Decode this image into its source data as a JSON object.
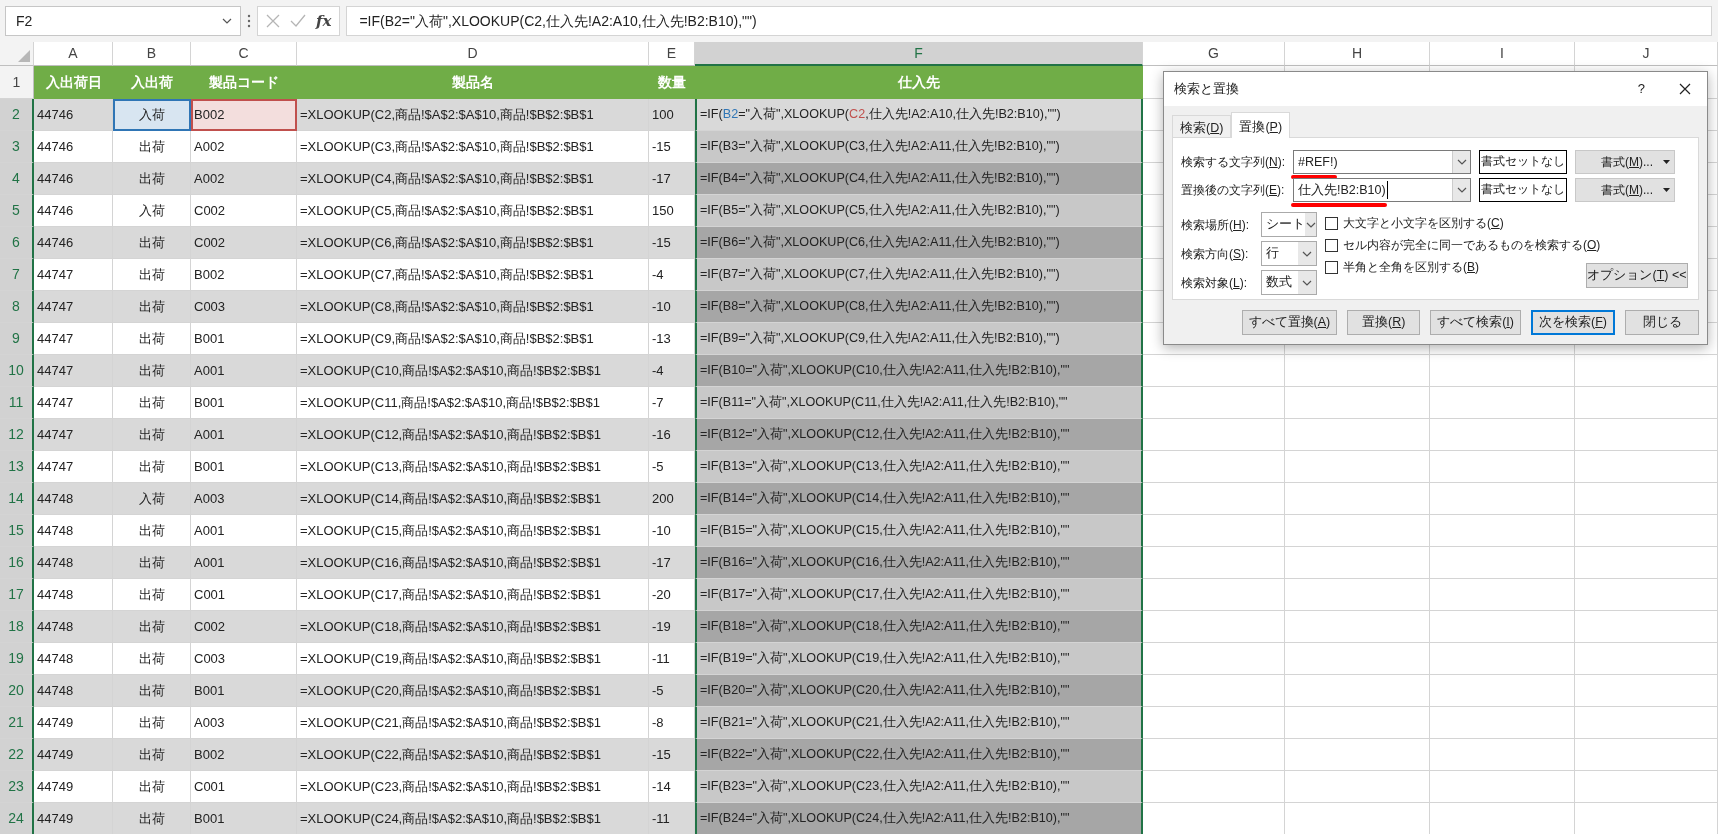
{
  "name_box": {
    "value": "F2"
  },
  "formula_bar": {
    "function_label": "fx",
    "value": "=IF(B2=\"入荷\",XLOOKUP(C2,仕入先!A2:A10,仕入先!B2:B10),\"\")"
  },
  "sheet": {
    "columns": [
      {
        "label": "A",
        "selected": false
      },
      {
        "label": "B",
        "selected": false
      },
      {
        "label": "C",
        "selected": false
      },
      {
        "label": "D",
        "selected": false
      },
      {
        "label": "E",
        "selected": false
      },
      {
        "label": "F",
        "selected": true
      },
      {
        "label": "G",
        "selected": false
      },
      {
        "label": "H",
        "selected": false
      },
      {
        "label": "I",
        "selected": false
      },
      {
        "label": "J",
        "selected": false
      }
    ],
    "header_row": {
      "number": "1",
      "selected": false,
      "cells": [
        "入出荷日",
        "入出荷",
        "製品コード",
        "製品名",
        "数量",
        "仕入先"
      ]
    },
    "rows": [
      {
        "number": "2",
        "selected": true,
        "active": true,
        "cells": [
          "44746",
          {
            "text": "入荷",
            "color": "#2f75b5"
          },
          {
            "text": "B002",
            "color": "#c0504d"
          },
          "=XLOOKUP(C2,商品!$A$2:$A$10,商品!$B$2:$B$1",
          "100",
          {
            "parts": [
              {
                "text": "=IF("
              },
              {
                "text": "B2",
                "color": "#2f75b5"
              },
              {
                "text": "=\"入荷\",XLOOKUP("
              },
              {
                "text": "C2",
                "color": "#c0504d"
              },
              {
                "text": ",仕入先!A2:A10,仕入先!B2:B10),\"\")"
              }
            ]
          }
        ]
      },
      {
        "number": "3",
        "selected": true,
        "cells": [
          "44746",
          "出荷",
          "A002",
          "=XLOOKUP(C3,商品!$A$2:$A$10,商品!$B$2:$B$1",
          "-15",
          "=IF(B3=\"入荷\",XLOOKUP(C3,仕入先!A2:A11,仕入先!B2:B10),\"\")"
        ]
      },
      {
        "number": "4",
        "selected": true,
        "cells": [
          "44746",
          "出荷",
          "A002",
          "=XLOOKUP(C4,商品!$A$2:$A$10,商品!$B$2:$B$1",
          "-17",
          "=IF(B4=\"入荷\",XLOOKUP(C4,仕入先!A2:A11,仕入先!B2:B10),\"\")"
        ]
      },
      {
        "number": "5",
        "selected": true,
        "cells": [
          "44746",
          "入荷",
          "C002",
          "=XLOOKUP(C5,商品!$A$2:$A$10,商品!$B$2:$B$1",
          "150",
          "=IF(B5=\"入荷\",XLOOKUP(C5,仕入先!A2:A11,仕入先!B2:B10),\"\")"
        ]
      },
      {
        "number": "6",
        "selected": true,
        "cells": [
          "44746",
          "出荷",
          "C002",
          "=XLOOKUP(C6,商品!$A$2:$A$10,商品!$B$2:$B$1",
          "-15",
          "=IF(B6=\"入荷\",XLOOKUP(C6,仕入先!A2:A11,仕入先!B2:B10),\"\")"
        ]
      },
      {
        "number": "7",
        "selected": true,
        "cells": [
          "44747",
          "出荷",
          "B002",
          "=XLOOKUP(C7,商品!$A$2:$A$10,商品!$B$2:$B$1",
          "-4",
          "=IF(B7=\"入荷\",XLOOKUP(C7,仕入先!A2:A11,仕入先!B2:B10),\"\")"
        ]
      },
      {
        "number": "8",
        "selected": true,
        "cells": [
          "44747",
          "出荷",
          "C003",
          "=XLOOKUP(C8,商品!$A$2:$A$10,商品!$B$2:$B$1",
          "-10",
          "=IF(B8=\"入荷\",XLOOKUP(C8,仕入先!A2:A11,仕入先!B2:B10),\"\")"
        ]
      },
      {
        "number": "9",
        "selected": true,
        "cells": [
          "44747",
          "出荷",
          "B001",
          "=XLOOKUP(C9,商品!$A$2:$A$10,商品!$B$2:$B$1",
          "-13",
          "=IF(B9=\"入荷\",XLOOKUP(C9,仕入先!A2:A11,仕入先!B2:B10),\"\")"
        ]
      },
      {
        "number": "10",
        "selected": true,
        "cells": [
          "44747",
          "出荷",
          "A001",
          "=XLOOKUP(C10,商品!$A$2:$A$10,商品!$B$2:$B$1",
          "-4",
          "=IF(B10=\"入荷\",XLOOKUP(C10,仕入先!A2:A11,仕入先!B2:B10),\"\""
        ]
      },
      {
        "number": "11",
        "selected": true,
        "cells": [
          "44747",
          "出荷",
          "B001",
          "=XLOOKUP(C11,商品!$A$2:$A$10,商品!$B$2:$B$1",
          "-7",
          "=IF(B11=\"入荷\",XLOOKUP(C11,仕入先!A2:A11,仕入先!B2:B10),\"\""
        ]
      },
      {
        "number": "12",
        "selected": true,
        "cells": [
          "44747",
          "出荷",
          "A001",
          "=XLOOKUP(C12,商品!$A$2:$A$10,商品!$B$2:$B$1",
          "-16",
          "=IF(B12=\"入荷\",XLOOKUP(C12,仕入先!A2:A11,仕入先!B2:B10),\"\""
        ]
      },
      {
        "number": "13",
        "selected": true,
        "cells": [
          "44747",
          "出荷",
          "B001",
          "=XLOOKUP(C13,商品!$A$2:$A$10,商品!$B$2:$B$1",
          "-5",
          "=IF(B13=\"入荷\",XLOOKUP(C13,仕入先!A2:A11,仕入先!B2:B10),\"\""
        ]
      },
      {
        "number": "14",
        "selected": true,
        "cells": [
          "44748",
          "入荷",
          "A003",
          "=XLOOKUP(C14,商品!$A$2:$A$10,商品!$B$2:$B$1",
          "200",
          "=IF(B14=\"入荷\",XLOOKUP(C14,仕入先!A2:A11,仕入先!B2:B10),\"\""
        ]
      },
      {
        "number": "15",
        "selected": true,
        "cells": [
          "44748",
          "出荷",
          "A001",
          "=XLOOKUP(C15,商品!$A$2:$A$10,商品!$B$2:$B$1",
          "-10",
          "=IF(B15=\"入荷\",XLOOKUP(C15,仕入先!A2:A11,仕入先!B2:B10),\"\""
        ]
      },
      {
        "number": "16",
        "selected": true,
        "cells": [
          "44748",
          "出荷",
          "A001",
          "=XLOOKUP(C16,商品!$A$2:$A$10,商品!$B$2:$B$1",
          "-17",
          "=IF(B16=\"入荷\",XLOOKUP(C16,仕入先!A2:A11,仕入先!B2:B10),\"\""
        ]
      },
      {
        "number": "17",
        "selected": true,
        "cells": [
          "44748",
          "出荷",
          "C001",
          "=XLOOKUP(C17,商品!$A$2:$A$10,商品!$B$2:$B$1",
          "-20",
          "=IF(B17=\"入荷\",XLOOKUP(C17,仕入先!A2:A11,仕入先!B2:B10),\"\""
        ]
      },
      {
        "number": "18",
        "selected": true,
        "cells": [
          "44748",
          "出荷",
          "C002",
          "=XLOOKUP(C18,商品!$A$2:$A$10,商品!$B$2:$B$1",
          "-19",
          "=IF(B18=\"入荷\",XLOOKUP(C18,仕入先!A2:A11,仕入先!B2:B10),\"\""
        ]
      },
      {
        "number": "19",
        "selected": true,
        "cells": [
          "44748",
          "出荷",
          "C003",
          "=XLOOKUP(C19,商品!$A$2:$A$10,商品!$B$2:$B$1",
          "-11",
          "=IF(B19=\"入荷\",XLOOKUP(C19,仕入先!A2:A11,仕入先!B2:B10),\"\""
        ]
      },
      {
        "number": "20",
        "selected": true,
        "cells": [
          "44748",
          "出荷",
          "B001",
          "=XLOOKUP(C20,商品!$A$2:$A$10,商品!$B$2:$B$1",
          "-5",
          "=IF(B20=\"入荷\",XLOOKUP(C20,仕入先!A2:A11,仕入先!B2:B10),\"\""
        ]
      },
      {
        "number": "21",
        "selected": true,
        "cells": [
          "44749",
          "出荷",
          "A003",
          "=XLOOKUP(C21,商品!$A$2:$A$10,商品!$B$2:$B$1",
          "-8",
          "=IF(B21=\"入荷\",XLOOKUP(C21,仕入先!A2:A11,仕入先!B2:B10),\"\""
        ]
      },
      {
        "number": "22",
        "selected": true,
        "cells": [
          "44749",
          "出荷",
          "B002",
          "=XLOOKUP(C22,商品!$A$2:$A$10,商品!$B$2:$B$1",
          "-15",
          "=IF(B22=\"入荷\",XLOOKUP(C22,仕入先!A2:A11,仕入先!B2:B10),\"\""
        ]
      },
      {
        "number": "23",
        "selected": true,
        "cells": [
          "44749",
          "出荷",
          "C001",
          "=XLOOKUP(C23,商品!$A$2:$A$10,商品!$B$2:$B$1",
          "-14",
          "=IF(B23=\"入荷\",XLOOKUP(C23,仕入先!A2:A11,仕入先!B2:B10),\"\""
        ]
      },
      {
        "number": "24",
        "selected": true,
        "cells": [
          "44749",
          "出荷",
          "B001",
          "=XLOOKUP(C24,商品!$A$2:$A$10,商品!$B$2:$B$1",
          "-11",
          "=IF(B24=\"入荷\",XLOOKUP(C24,仕入先!A2:A11,仕入先!B2:B10),\"\""
        ]
      }
    ]
  },
  "dialog": {
    "title": "検索と置換",
    "help": "?",
    "tabs": [
      {
        "label": "検索(D)",
        "selected": false
      },
      {
        "label": "置換(P)",
        "selected": true
      }
    ],
    "find": {
      "label": "検索する文字列(N):",
      "value": "#REF!)",
      "annotated": true,
      "focused": false,
      "format_status": "書式セットなし",
      "format_button": "書式(M)..."
    },
    "replace": {
      "label": "置換後の文字列(E):",
      "value": "仕入先!B2:B10)",
      "annotated": true,
      "focused": true,
      "format_status": "書式セットなし",
      "format_button": "書式(M)..."
    },
    "selects": [
      {
        "label": "検索場所(H):",
        "value": "シート"
      },
      {
        "label": "検索方向(S):",
        "value": "行"
      },
      {
        "label": "検索対象(L):",
        "value": "数式"
      }
    ],
    "options": [
      {
        "label": "大文字と小文字を区別する(C)",
        "checked": false
      },
      {
        "label": "セル内容が完全に同一であるものを検索する(O)",
        "checked": false
      },
      {
        "label": "半角と全角を区別する(B)",
        "checked": false
      }
    ],
    "options_button": "オプション(T) <<",
    "buttons": [
      {
        "label": "すべて置換(A)",
        "default": false
      },
      {
        "label": "置換(R)",
        "default": false
      },
      {
        "label": "すべて検索(I)",
        "default": false
      },
      {
        "label": "次を検索(F)",
        "default": true
      },
      {
        "label": "閉じる",
        "default": false
      }
    ]
  }
}
